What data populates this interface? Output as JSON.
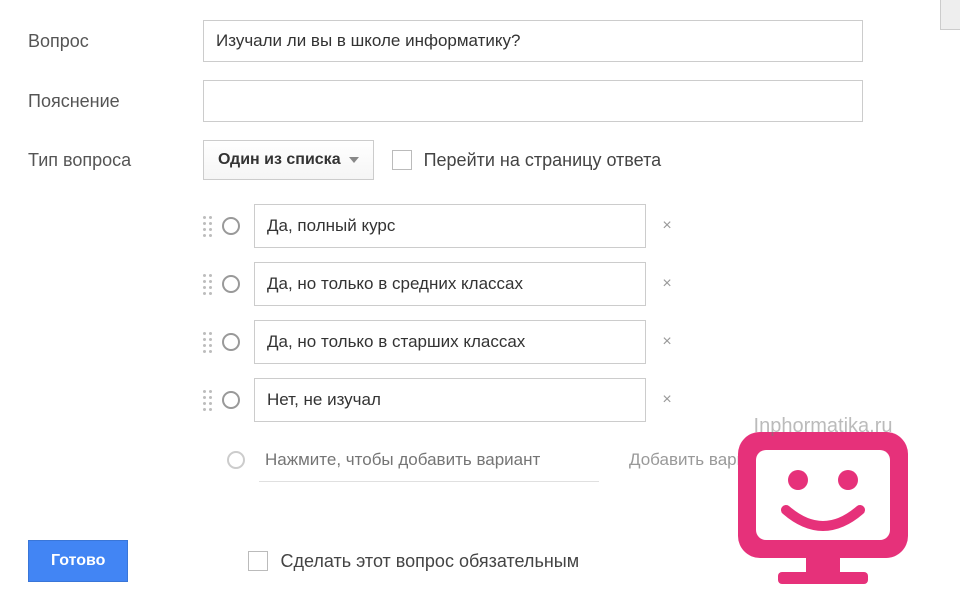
{
  "labels": {
    "question": "Вопрос",
    "description": "Пояснение",
    "question_type": "Тип вопроса"
  },
  "fields": {
    "question_value": "Изучали ли вы в школе информатику?",
    "description_value": ""
  },
  "type_dropdown": {
    "selected": "Один из списка"
  },
  "go_to_page_checkbox": {
    "label": "Перейти на страницу ответа"
  },
  "options": [
    {
      "text": "Да, полный курс"
    },
    {
      "text": "Да, но только в средних классах"
    },
    {
      "text": "Да, но только в старших классах"
    },
    {
      "text": "Нет, не изучал"
    }
  ],
  "add_option_placeholder": "Нажмите, чтобы добавить вариант",
  "add_other_text": "Добавить вариант \"Другое\"",
  "footer": {
    "done_button": "Готово",
    "required_label": "Сделать этот вопрос обязательным"
  },
  "watermark": "Inphormatika.ru"
}
